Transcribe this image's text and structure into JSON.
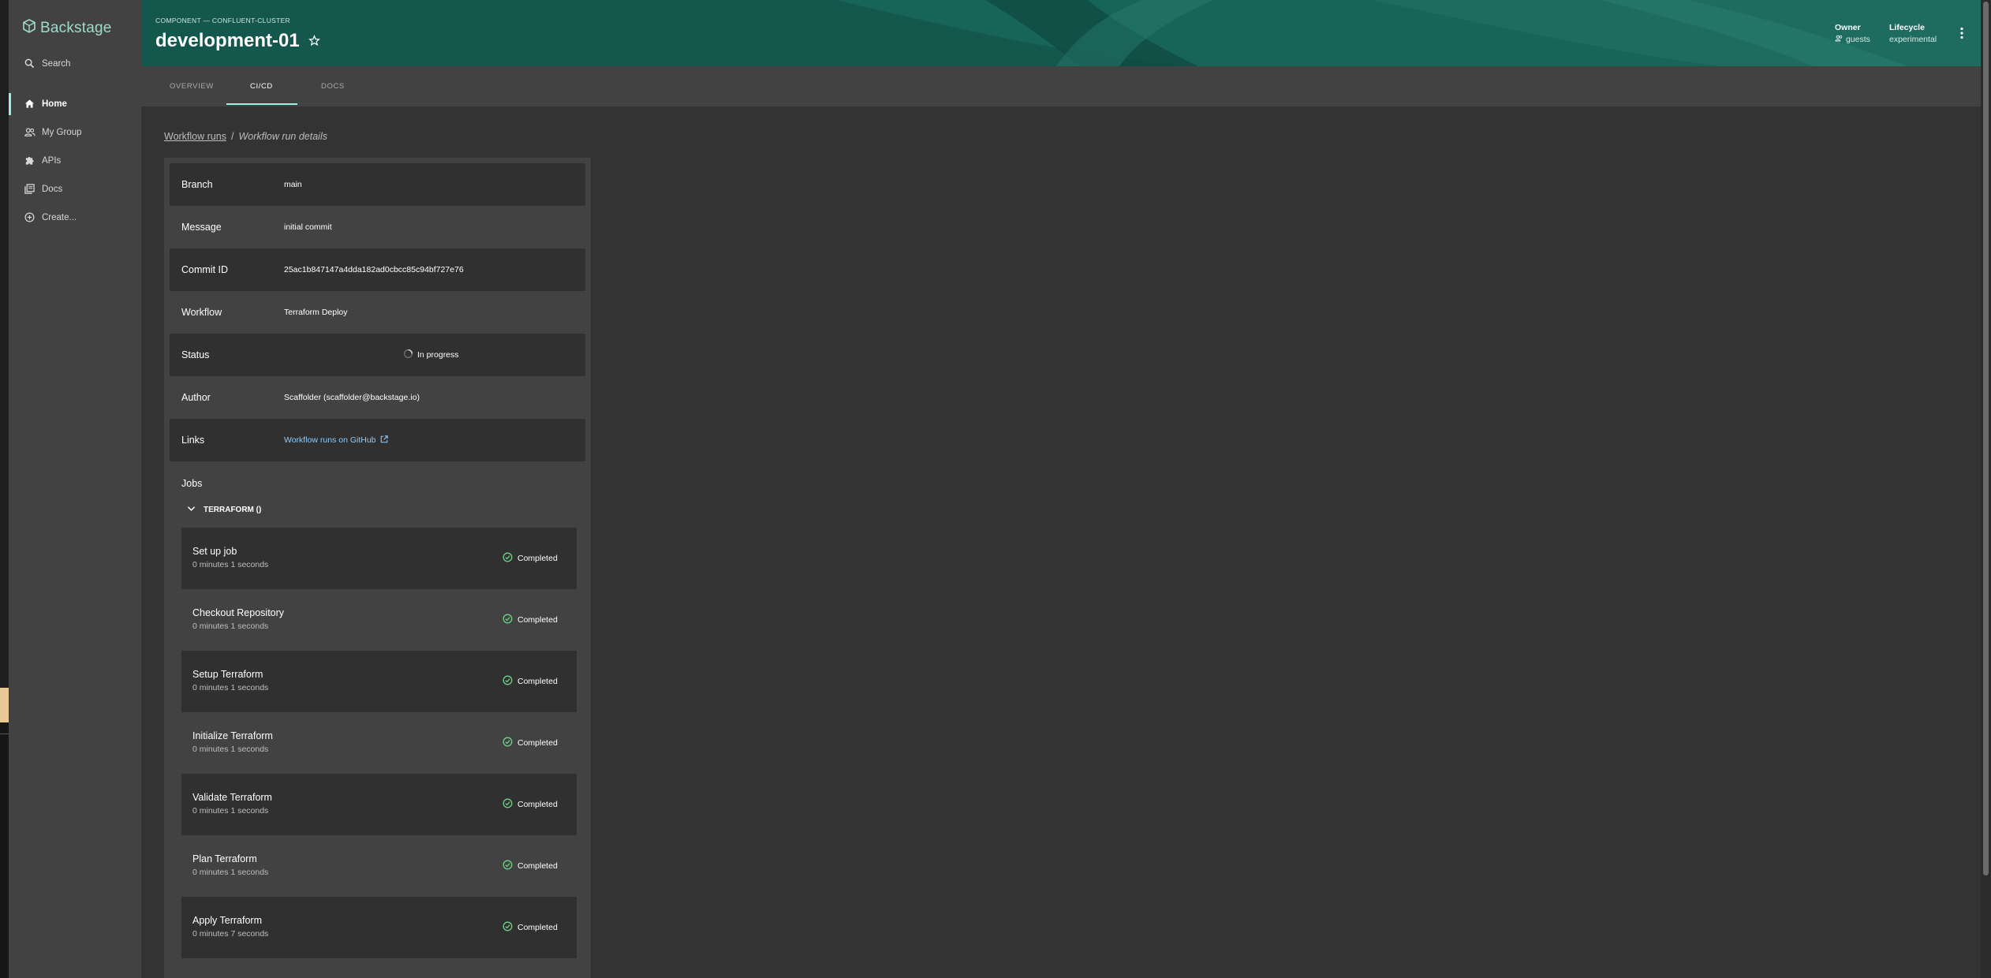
{
  "app": {
    "name": "Backstage"
  },
  "sidebar": {
    "search_label": "Search",
    "items": [
      {
        "label": "Home",
        "icon": "home-icon",
        "active": true
      },
      {
        "label": "My Group",
        "icon": "group-icon"
      },
      {
        "label": "APIs",
        "icon": "puzzle-icon"
      },
      {
        "label": "Docs",
        "icon": "library-icon"
      },
      {
        "label": "Create...",
        "icon": "add-circle-icon"
      }
    ]
  },
  "header": {
    "kind_line": "COMPONENT — CONFLUENT-CLUSTER",
    "title": "development-01",
    "owner_label": "Owner",
    "owner_value": "guests",
    "lifecycle_label": "Lifecycle",
    "lifecycle_value": "experimental"
  },
  "tabs": [
    {
      "label": "OVERVIEW"
    },
    {
      "label": "CI/CD",
      "active": true
    },
    {
      "label": "DOCS"
    }
  ],
  "breadcrumb": {
    "parent": "Workflow runs",
    "separator": "/",
    "current": "Workflow run details"
  },
  "details": {
    "branch_label": "Branch",
    "branch_value": "main",
    "message_label": "Message",
    "message_value": "initial commit",
    "commit_label": "Commit ID",
    "commit_value": "25ac1b847147a4dda182ad0cbcc85c94bf727e76",
    "workflow_label": "Workflow",
    "workflow_value": "Terraform Deploy",
    "status_label": "Status",
    "status_value": "In progress",
    "author_label": "Author",
    "author_value": "Scaffolder (scaffolder@backstage.io)",
    "links_label": "Links",
    "links_value": "Workflow runs on GitHub"
  },
  "jobs": {
    "label": "Jobs",
    "group_name": "TERRAFORM ()",
    "steps": [
      {
        "name": "Set up job",
        "duration": "0 minutes 1 seconds",
        "status": "Completed"
      },
      {
        "name": "Checkout Repository",
        "duration": "0 minutes 1 seconds",
        "status": "Completed"
      },
      {
        "name": "Setup Terraform",
        "duration": "0 minutes 1 seconds",
        "status": "Completed"
      },
      {
        "name": "Initialize Terraform",
        "duration": "0 minutes 1 seconds",
        "status": "Completed"
      },
      {
        "name": "Validate Terraform",
        "duration": "0 minutes 1 seconds",
        "status": "Completed"
      },
      {
        "name": "Plan Terraform",
        "duration": "0 minutes 1 seconds",
        "status": "Completed"
      },
      {
        "name": "Apply Terraform",
        "duration": "0 minutes 7 seconds",
        "status": "Completed"
      }
    ]
  },
  "colors": {
    "accent": "#9bf0e1",
    "header": "#13574d",
    "success": "#71cf88",
    "link": "#90caf9"
  }
}
